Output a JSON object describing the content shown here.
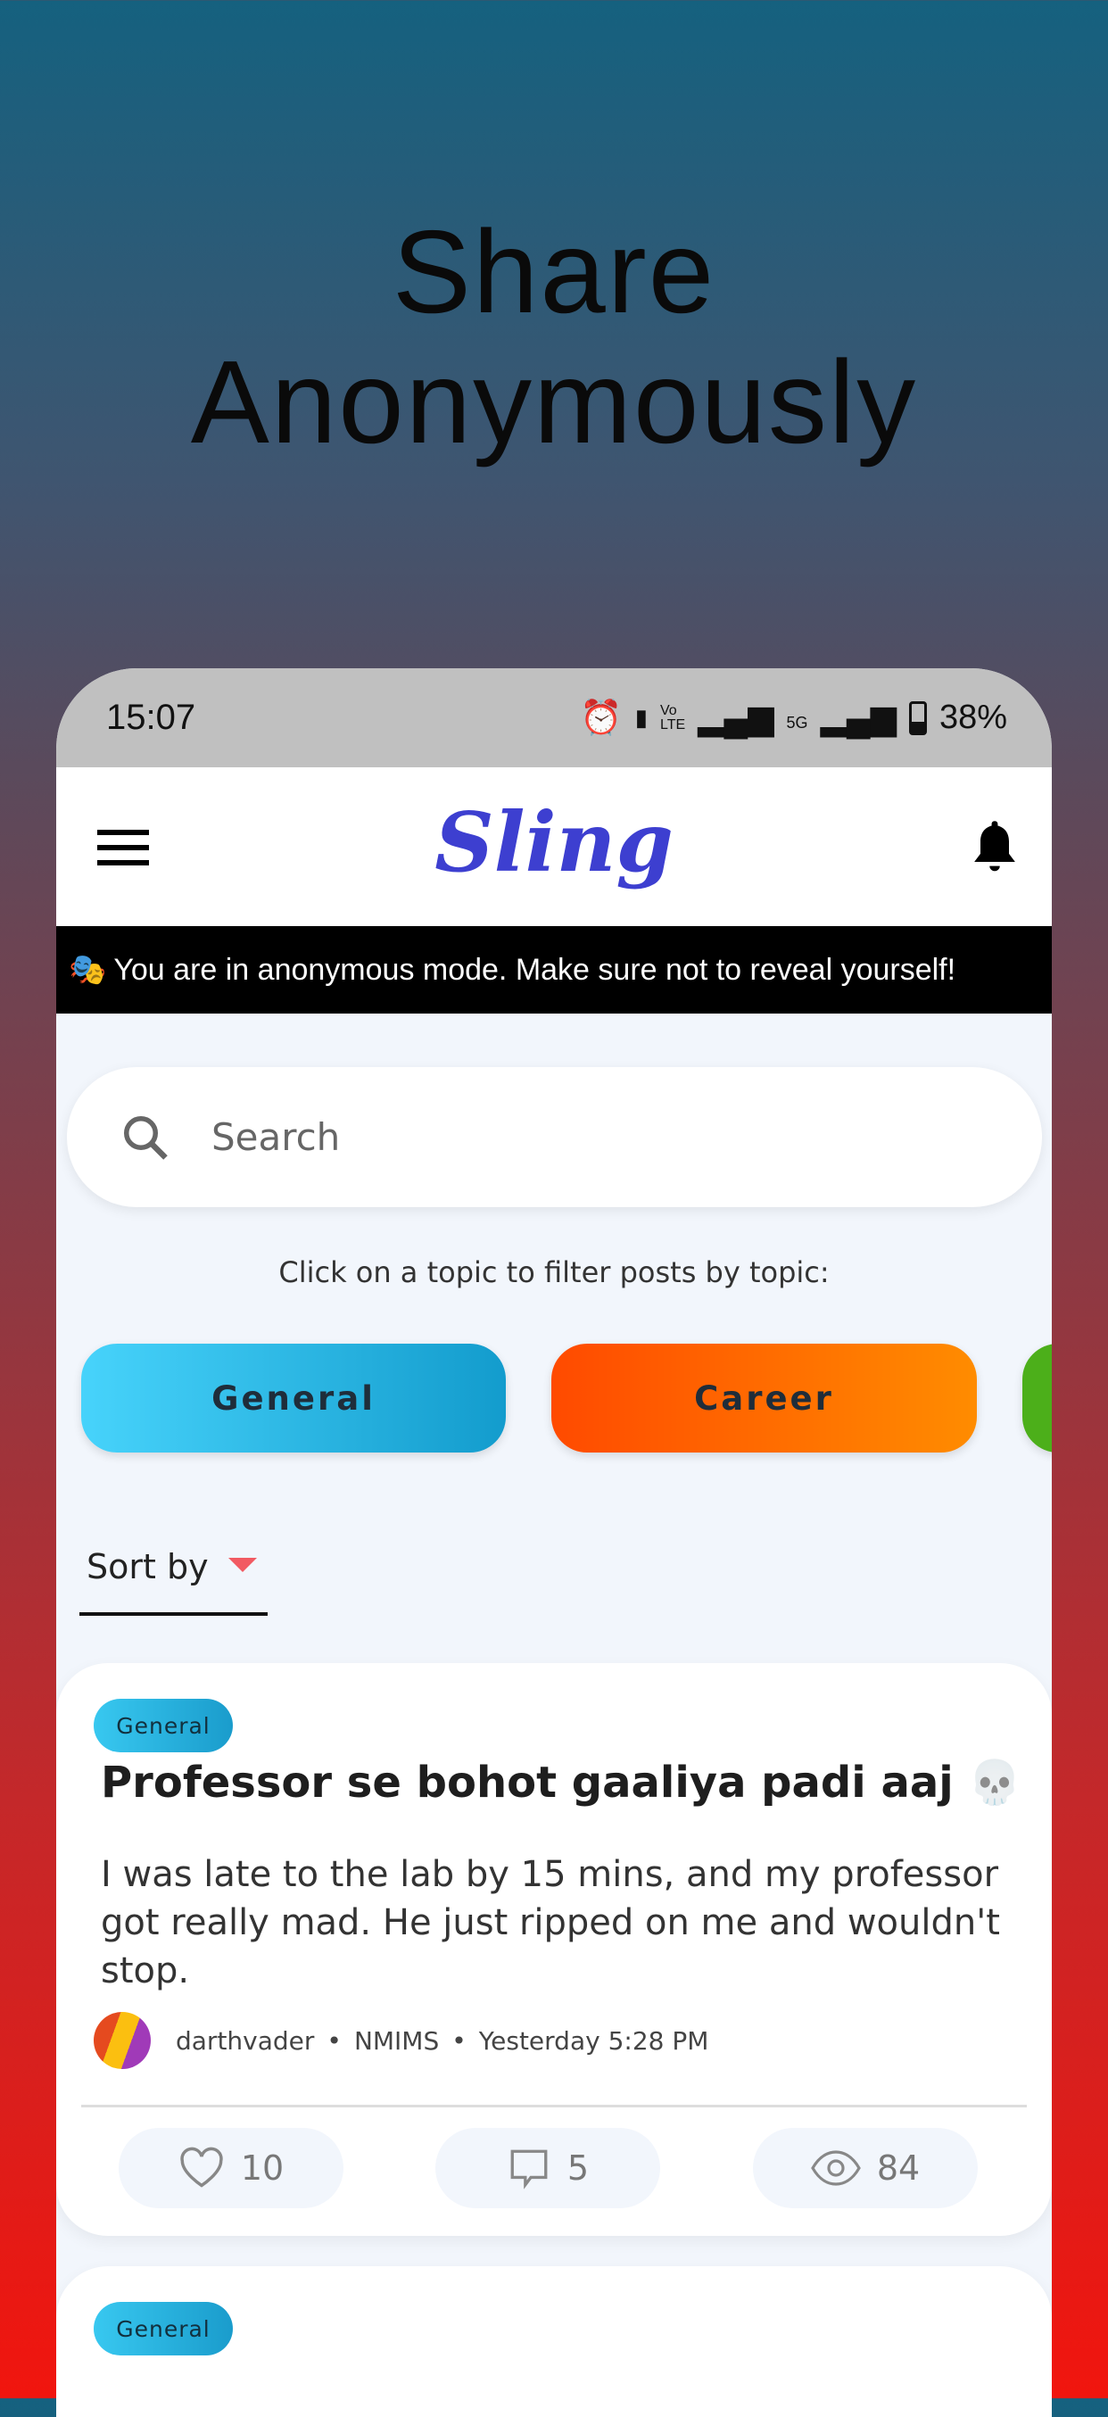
{
  "promo": {
    "line1": "Share",
    "line2": "Anonymously"
  },
  "status_bar": {
    "time": "15:07",
    "battery": "38%",
    "network": "5G"
  },
  "header": {
    "logo": "Sling"
  },
  "banner": {
    "emoji": "🎭",
    "text": "You are in anonymous mode. Make sure not to reveal yourself!"
  },
  "search": {
    "placeholder": "Search"
  },
  "topics": {
    "hint": "Click on a topic to filter posts by topic:",
    "items": [
      {
        "label": "General",
        "color": "#3ec9f3"
      },
      {
        "label": "Career",
        "color": "#ff5a00"
      },
      {
        "label": "",
        "color": "#4caf1a"
      }
    ]
  },
  "sort": {
    "label": "Sort by"
  },
  "posts": [
    {
      "tag": "General",
      "title": "Professor se bohot gaaliya padi aaj",
      "emoji": "💀",
      "body": "I was late to the lab by 15 mins, and my professor got really mad. He just ripped on me and wouldn't stop.",
      "author": "darthvader",
      "college": "NMIMS",
      "time": "Yesterday 5:28 PM",
      "likes": "10",
      "comments": "5",
      "views": "84"
    },
    {
      "tag": "General"
    }
  ]
}
